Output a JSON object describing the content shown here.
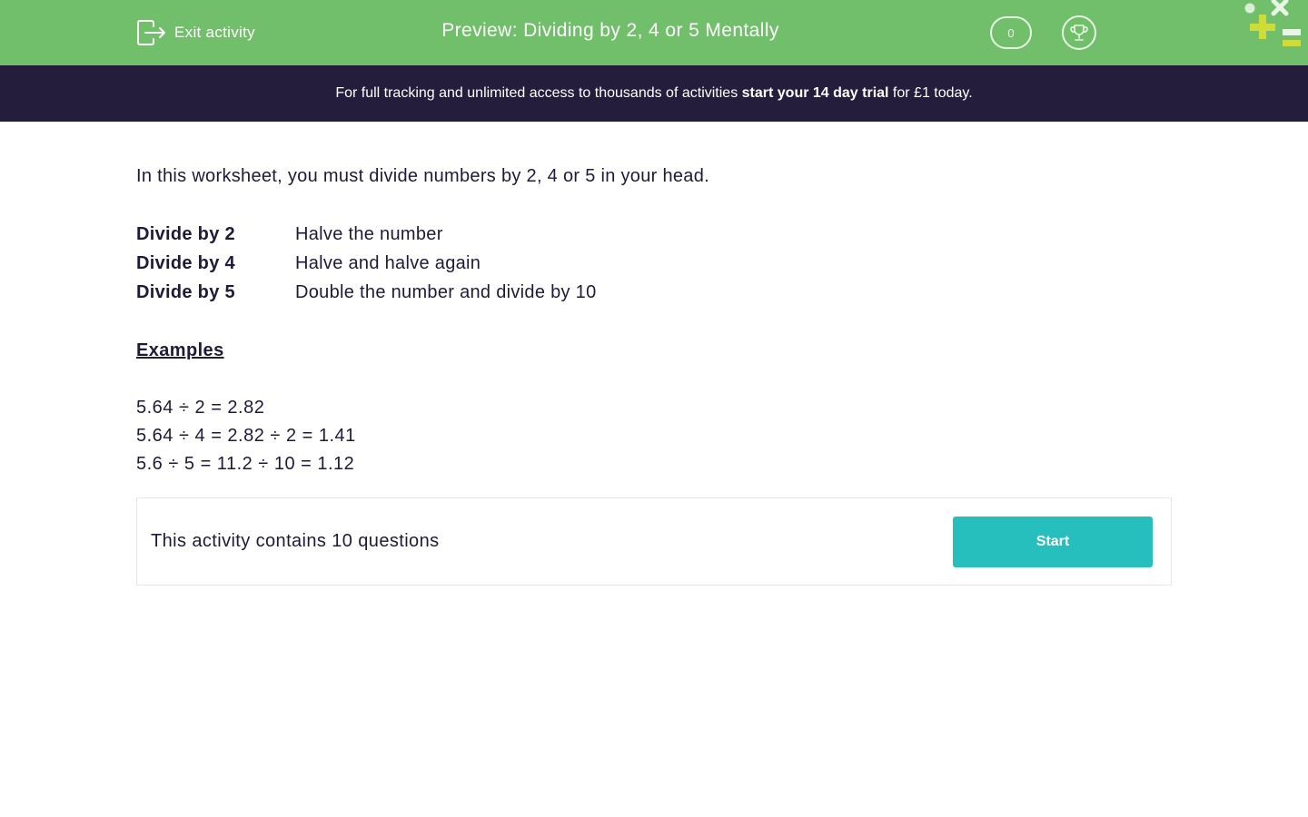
{
  "header": {
    "exit_label": "Exit activity",
    "title": "Preview: Dividing by 2, 4 or 5 Mentally",
    "score": "0"
  },
  "promo": {
    "text_before": "For full tracking and unlimited access to thousands of activities ",
    "text_bold": "start your 14 day trial",
    "text_after": " for £1 today."
  },
  "main": {
    "intro": "In this worksheet, you must divide numbers by 2, 4 or 5 in your head.",
    "rules": [
      {
        "key": "Divide by 2",
        "value": "Halve the number"
      },
      {
        "key": "Divide by 4",
        "value": "Halve and halve again"
      },
      {
        "key": "Divide by 5",
        "value": "Double the number and divide by 10"
      }
    ],
    "examples_heading": "Examples",
    "examples": [
      "5.64 ÷ 2 = 2.82",
      "5.64 ÷ 4 = 2.82 ÷ 2 = 1.41",
      "5.6 ÷ 5 = 11.2 ÷ 10 = 1.12"
    ]
  },
  "activity": {
    "summary": "This activity contains 10 questions",
    "start_label": "Start"
  },
  "colors": {
    "header_green": "#71bf6b",
    "promo_bg": "#241d3c",
    "start_teal": "#26bfbe",
    "text_dark": "#1f1a3a"
  },
  "icons": {
    "exit": "exit-icon",
    "trophy": "trophy-icon",
    "logo": "math-symbols-logo"
  }
}
